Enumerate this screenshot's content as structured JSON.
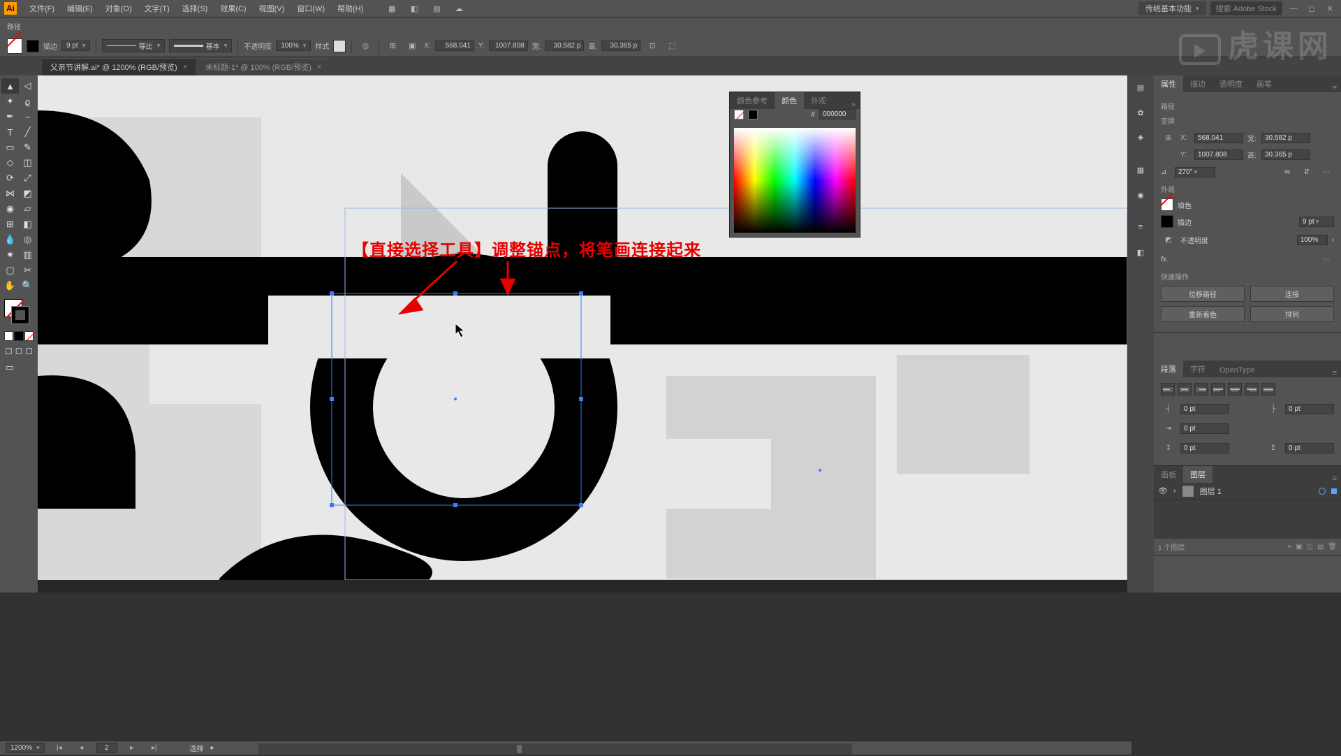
{
  "app": {
    "logo": "Ai"
  },
  "menu": {
    "items": [
      "文件(F)",
      "编辑(E)",
      "对象(O)",
      "文字(T)",
      "选择(S)",
      "效果(C)",
      "视图(V)",
      "窗口(W)",
      "帮助(H)"
    ],
    "workspace": "传统基本功能",
    "search_placeholder": "搜索 Adobe Stock"
  },
  "ctrl1": {
    "label": "路径"
  },
  "ctrl2": {
    "stroke_label": "描边",
    "stroke_val": "9 pt",
    "profile": "等比",
    "brush": "基本",
    "opacity_label": "不透明度",
    "opacity_val": "100%",
    "style_label": "样式",
    "x_label": "X:",
    "x_val": "568.041",
    "y_label": "Y:",
    "y_val": "1007.808",
    "w_label": "宽:",
    "w_val": "30.582 p",
    "h_label": "高:",
    "h_val": "30.365 p"
  },
  "tabs": [
    {
      "title": "父亲节讲解.ai* @ 1200% (RGB/预览)",
      "active": true
    },
    {
      "title": "未标题-1* @ 100% (RGB/预览)",
      "active": false
    }
  ],
  "annotation_text": "【直接选择工具】调整锚点，将笔画连接起来",
  "properties": {
    "tabs": [
      "属性",
      "描边",
      "透明度",
      "画笔"
    ],
    "sect_path": "路径",
    "sect_transform": "变换",
    "x": "568.041",
    "y": "1007.808",
    "w": "30.582 p",
    "h": "30.365 p",
    "rotate": "270°",
    "sect_appearance": "外观",
    "fill_label": "填色",
    "stroke_label": "描边",
    "stroke_val": "9 pt",
    "opacity_label": "不透明度",
    "opacity_val": "100%",
    "fx_label": "fx.",
    "sect_quick": "快速操作",
    "btn_offset": "位移路径",
    "btn_join": "连接",
    "btn_recolor": "重新着色",
    "btn_arrange": "排列"
  },
  "color_panel": {
    "tabs": [
      "颜色参考",
      "颜色",
      "外观"
    ],
    "hex": "000000"
  },
  "para_panel": {
    "tabs": [
      "段落",
      "字符",
      "OpenType"
    ],
    "left_indent": "0 pt",
    "right_indent": "0 pt",
    "first_indent": "0 pt",
    "space_before": "0 pt",
    "space_after": "0 pt"
  },
  "layers_panel": {
    "tabs": [
      "画板",
      "图层"
    ],
    "layer_name": "图层 1",
    "footer": "1 个图层"
  },
  "status": {
    "zoom": "1200%",
    "artboard_nav": "2",
    "tool": "选择"
  },
  "watermark": "虎课网"
}
